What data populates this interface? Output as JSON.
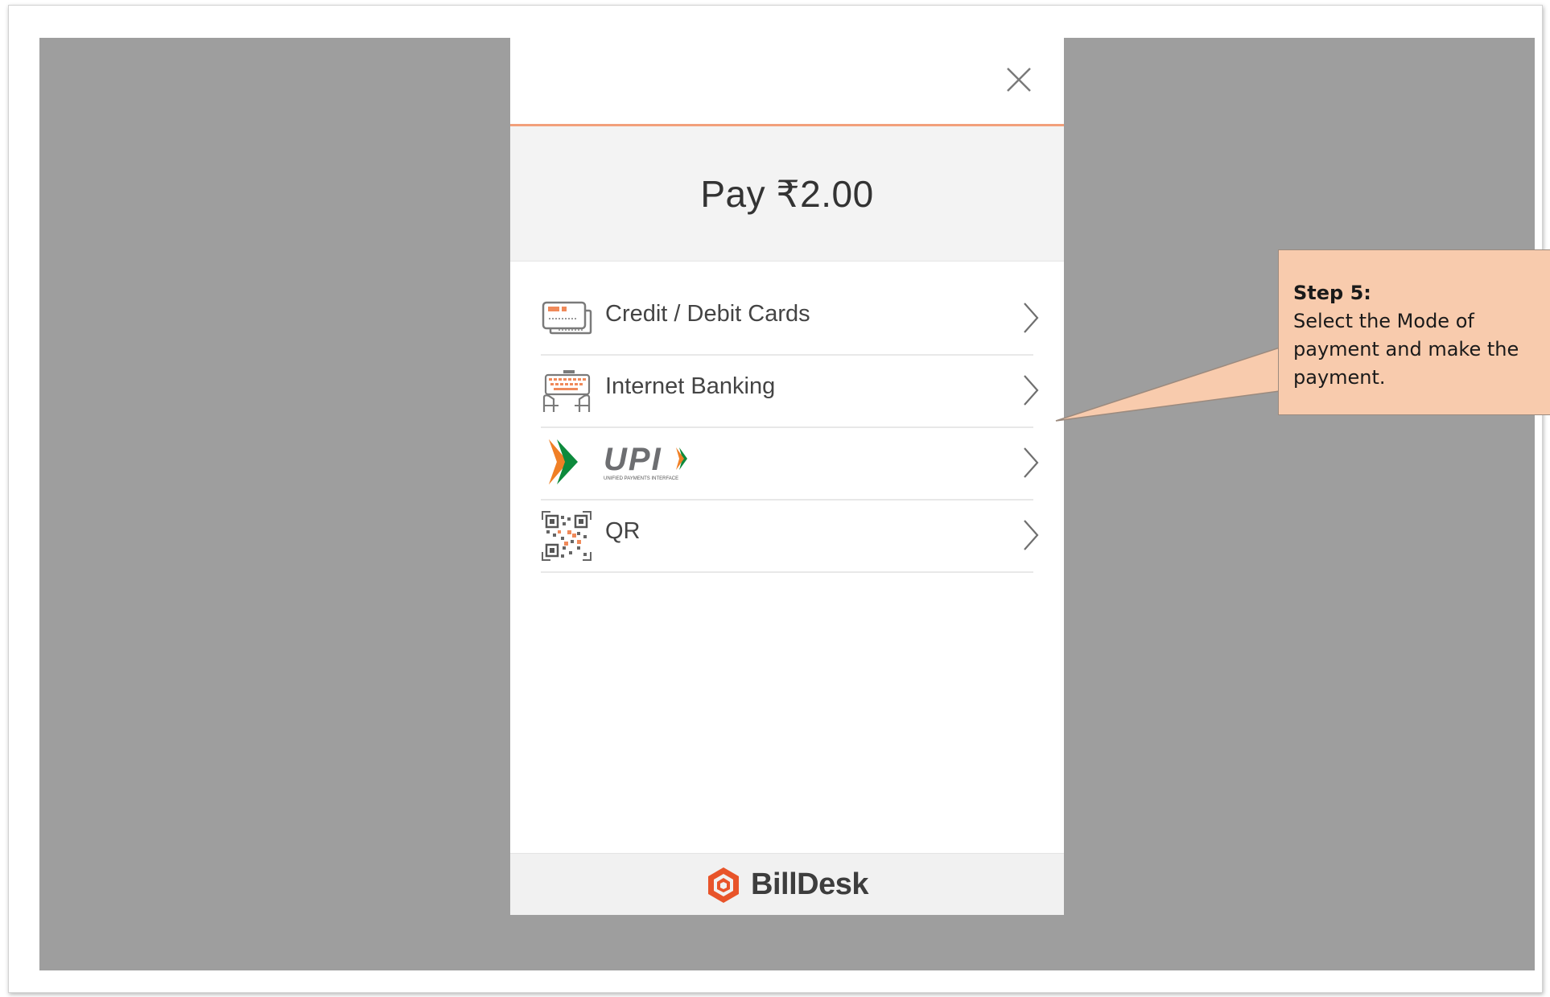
{
  "modal": {
    "close_icon": "close-icon",
    "pay_title": "Pay ₹2.00"
  },
  "methods": [
    {
      "label": "Credit / Debit Cards",
      "icon": "credit-card-icon"
    },
    {
      "label": "Internet Banking",
      "icon": "internet-banking-icon"
    },
    {
      "label": "",
      "icon": "upi-logo"
    },
    {
      "label": "QR",
      "icon": "qr-code-icon"
    }
  ],
  "upi_logo_text": "UPI",
  "upi_tagline": "UNIFIED PAYMENTS INTERFACE",
  "footer": {
    "brand": "BillDesk",
    "brand_icon": "billdesk-logo-icon"
  },
  "callout": {
    "title": "Step 5:",
    "text": "Select the Mode of payment and make the payment."
  },
  "colors": {
    "overlay": "#9e9e9e",
    "accent": "#f2a07b",
    "callout_bg": "#f8cbad",
    "billdesk_orange": "#e8542a",
    "upi_green": "#0d8a3c",
    "upi_orange": "#f07f25"
  }
}
